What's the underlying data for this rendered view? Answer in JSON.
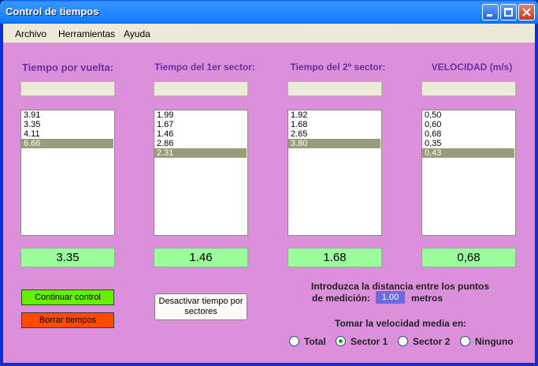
{
  "window": {
    "title": "Control de tiempos"
  },
  "menu": [
    "Archivo",
    "Herramientas",
    "Ayuda"
  ],
  "columns": [
    {
      "header": "Tiempo por vuelta:",
      "items": [
        "3.91",
        "3.35",
        "4.11",
        "6.66"
      ],
      "selected": 3,
      "result": "3.35"
    },
    {
      "header": "Tiempo del 1er sector:",
      "items": [
        "1.99",
        "1.67",
        "1.46",
        "2.86",
        "2.31"
      ],
      "selected": 4,
      "result": "1.46"
    },
    {
      "header": "Tiempo del 2º sector:",
      "items": [
        "1.92",
        "1.68",
        "2.65",
        "3.80"
      ],
      "selected": 3,
      "result": "1.68"
    },
    {
      "header": "VELOCIDAD (m/s)",
      "items": [
        "0,50",
        "0,60",
        "0,68",
        "0,35",
        "0,43"
      ],
      "selected": 4,
      "result": "0,68"
    }
  ],
  "buttons": {
    "continuar": "Continuar control",
    "borrar": "Borrar tiempos",
    "desactivar_line1": "Desactivar tiempo por",
    "desactivar_line2": "sectores"
  },
  "distance": {
    "prompt_line1": "Introduzca la distancia entre los puntos",
    "prompt_line2": "de medición:",
    "value": "1.00",
    "unit": "metros"
  },
  "speed_mode": {
    "label": "Tomar la velocidad media en:",
    "options": [
      "Total",
      "Sector 1",
      "Sector 2",
      "Ninguno"
    ],
    "selected": "Sector 1"
  },
  "colors": {
    "client_bg": "#dc90dc",
    "result_bg": "#9afc9a",
    "continue_btn": "#66f000",
    "delete_btn": "#ff4b00"
  }
}
